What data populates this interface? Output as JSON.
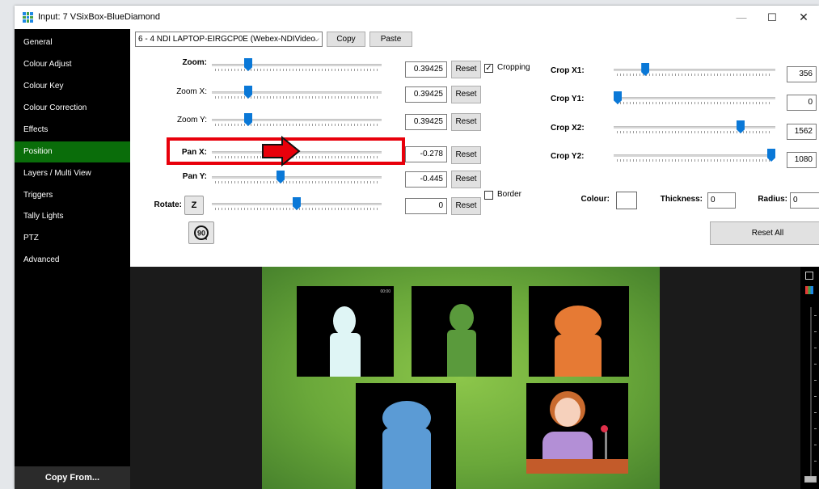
{
  "window": {
    "title": "Input: 7 VSixBox-BlueDiamond",
    "minimize_glyph": "—",
    "maximize_glyph": "☐",
    "close_glyph": "✕"
  },
  "sidebar": {
    "items": [
      {
        "label": "General"
      },
      {
        "label": "Colour Adjust"
      },
      {
        "label": "Colour Key"
      },
      {
        "label": "Colour Correction"
      },
      {
        "label": "Effects"
      },
      {
        "label": "Position"
      },
      {
        "label": "Layers / Multi View"
      },
      {
        "label": "Triggers"
      },
      {
        "label": "Tally Lights"
      },
      {
        "label": "PTZ"
      },
      {
        "label": "Advanced"
      }
    ],
    "active_item": "Position",
    "copy_from_label": "Copy From..."
  },
  "toolbar": {
    "source_value": "6 - 4 NDI LAPTOP-EIRGCP0E (Webex-NDIVideo",
    "copy_label": "Copy",
    "paste_label": "Paste"
  },
  "position": {
    "zoom": {
      "label": "Zoom:",
      "value": "0.39425",
      "slider_fraction": 0.2,
      "reset_label": "Reset"
    },
    "zoom_x": {
      "label": "Zoom X:",
      "value": "0.39425",
      "slider_fraction": 0.2,
      "reset_label": "Reset"
    },
    "zoom_y": {
      "label": "Zoom Y:",
      "value": "0.39425",
      "slider_fraction": 0.2,
      "reset_label": "Reset"
    },
    "pan_x": {
      "label": "Pan X:",
      "value": "-0.278",
      "slider_fraction": 0.43,
      "reset_label": "Reset"
    },
    "pan_y": {
      "label": "Pan Y:",
      "value": "-0.445",
      "slider_fraction": 0.4,
      "reset_label": "Reset"
    },
    "rotate": {
      "label": "Rotate:",
      "z_label": "Z",
      "value": "0",
      "slider_fraction": 0.5,
      "reset_label": "Reset",
      "rotate90_label": "90"
    }
  },
  "cropping": {
    "label": "Cropping",
    "checked": true,
    "crop_x1": {
      "label": "Crop X1:",
      "value": "356",
      "slider_fraction": 0.18
    },
    "crop_y1": {
      "label": "Crop Y1:",
      "value": "0",
      "slider_fraction": 0.0
    },
    "crop_x2": {
      "label": "Crop X2:",
      "value": "1562",
      "slider_fraction": 0.8
    },
    "crop_y2": {
      "label": "Crop Y2:",
      "value": "1080",
      "slider_fraction": 1.0
    }
  },
  "border": {
    "label": "Border",
    "checked": false,
    "colour_label": "Colour:",
    "colour_value": "#ffffff",
    "thickness_label": "Thickness:",
    "thickness_value": "0",
    "radius_label": "Radius:",
    "radius_value": "0"
  },
  "reset_all_label": "Reset All",
  "preview": {
    "tile_time": "00:00"
  },
  "colors": {
    "sidebar_bg": "#000000",
    "active_item": "#0a6d0a",
    "slider_thumb": "#0a78d7",
    "highlight": "#e8000b",
    "scene_green": "#8cc64a"
  },
  "icons": [
    "app-grid-icon",
    "minimize-icon",
    "maximize-icon",
    "close-icon",
    "rotate-90-icon",
    "checkbox-check-icon",
    "dropdown-chevron-icon",
    "arrow-pointer-icon"
  ]
}
